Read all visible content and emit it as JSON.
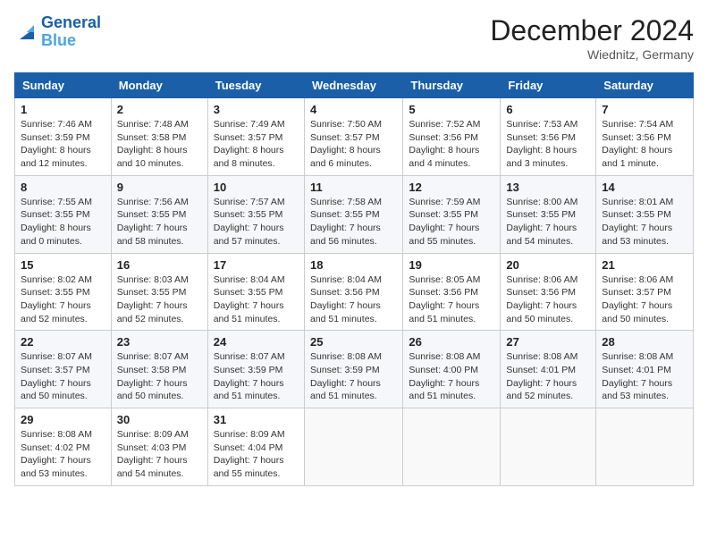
{
  "header": {
    "logo_line1": "General",
    "logo_line2": "Blue",
    "month": "December 2024",
    "location": "Wiednitz, Germany"
  },
  "weekdays": [
    "Sunday",
    "Monday",
    "Tuesday",
    "Wednesday",
    "Thursday",
    "Friday",
    "Saturday"
  ],
  "weeks": [
    [
      {
        "day": "1",
        "sunrise": "7:46 AM",
        "sunset": "3:59 PM",
        "daylight": "8 hours and 12 minutes."
      },
      {
        "day": "2",
        "sunrise": "7:48 AM",
        "sunset": "3:58 PM",
        "daylight": "8 hours and 10 minutes."
      },
      {
        "day": "3",
        "sunrise": "7:49 AM",
        "sunset": "3:57 PM",
        "daylight": "8 hours and 8 minutes."
      },
      {
        "day": "4",
        "sunrise": "7:50 AM",
        "sunset": "3:57 PM",
        "daylight": "8 hours and 6 minutes."
      },
      {
        "day": "5",
        "sunrise": "7:52 AM",
        "sunset": "3:56 PM",
        "daylight": "8 hours and 4 minutes."
      },
      {
        "day": "6",
        "sunrise": "7:53 AM",
        "sunset": "3:56 PM",
        "daylight": "8 hours and 3 minutes."
      },
      {
        "day": "7",
        "sunrise": "7:54 AM",
        "sunset": "3:56 PM",
        "daylight": "8 hours and 1 minute."
      }
    ],
    [
      {
        "day": "8",
        "sunrise": "7:55 AM",
        "sunset": "3:55 PM",
        "daylight": "8 hours and 0 minutes."
      },
      {
        "day": "9",
        "sunrise": "7:56 AM",
        "sunset": "3:55 PM",
        "daylight": "7 hours and 58 minutes."
      },
      {
        "day": "10",
        "sunrise": "7:57 AM",
        "sunset": "3:55 PM",
        "daylight": "7 hours and 57 minutes."
      },
      {
        "day": "11",
        "sunrise": "7:58 AM",
        "sunset": "3:55 PM",
        "daylight": "7 hours and 56 minutes."
      },
      {
        "day": "12",
        "sunrise": "7:59 AM",
        "sunset": "3:55 PM",
        "daylight": "7 hours and 55 minutes."
      },
      {
        "day": "13",
        "sunrise": "8:00 AM",
        "sunset": "3:55 PM",
        "daylight": "7 hours and 54 minutes."
      },
      {
        "day": "14",
        "sunrise": "8:01 AM",
        "sunset": "3:55 PM",
        "daylight": "7 hours and 53 minutes."
      }
    ],
    [
      {
        "day": "15",
        "sunrise": "8:02 AM",
        "sunset": "3:55 PM",
        "daylight": "7 hours and 52 minutes."
      },
      {
        "day": "16",
        "sunrise": "8:03 AM",
        "sunset": "3:55 PM",
        "daylight": "7 hours and 52 minutes."
      },
      {
        "day": "17",
        "sunrise": "8:04 AM",
        "sunset": "3:55 PM",
        "daylight": "7 hours and 51 minutes."
      },
      {
        "day": "18",
        "sunrise": "8:04 AM",
        "sunset": "3:56 PM",
        "daylight": "7 hours and 51 minutes."
      },
      {
        "day": "19",
        "sunrise": "8:05 AM",
        "sunset": "3:56 PM",
        "daylight": "7 hours and 51 minutes."
      },
      {
        "day": "20",
        "sunrise": "8:06 AM",
        "sunset": "3:56 PM",
        "daylight": "7 hours and 50 minutes."
      },
      {
        "day": "21",
        "sunrise": "8:06 AM",
        "sunset": "3:57 PM",
        "daylight": "7 hours and 50 minutes."
      }
    ],
    [
      {
        "day": "22",
        "sunrise": "8:07 AM",
        "sunset": "3:57 PM",
        "daylight": "7 hours and 50 minutes."
      },
      {
        "day": "23",
        "sunrise": "8:07 AM",
        "sunset": "3:58 PM",
        "daylight": "7 hours and 50 minutes."
      },
      {
        "day": "24",
        "sunrise": "8:07 AM",
        "sunset": "3:59 PM",
        "daylight": "7 hours and 51 minutes."
      },
      {
        "day": "25",
        "sunrise": "8:08 AM",
        "sunset": "3:59 PM",
        "daylight": "7 hours and 51 minutes."
      },
      {
        "day": "26",
        "sunrise": "8:08 AM",
        "sunset": "4:00 PM",
        "daylight": "7 hours and 51 minutes."
      },
      {
        "day": "27",
        "sunrise": "8:08 AM",
        "sunset": "4:01 PM",
        "daylight": "7 hours and 52 minutes."
      },
      {
        "day": "28",
        "sunrise": "8:08 AM",
        "sunset": "4:01 PM",
        "daylight": "7 hours and 53 minutes."
      }
    ],
    [
      {
        "day": "29",
        "sunrise": "8:08 AM",
        "sunset": "4:02 PM",
        "daylight": "7 hours and 53 minutes."
      },
      {
        "day": "30",
        "sunrise": "8:09 AM",
        "sunset": "4:03 PM",
        "daylight": "7 hours and 54 minutes."
      },
      {
        "day": "31",
        "sunrise": "8:09 AM",
        "sunset": "4:04 PM",
        "daylight": "7 hours and 55 minutes."
      },
      null,
      null,
      null,
      null
    ]
  ]
}
